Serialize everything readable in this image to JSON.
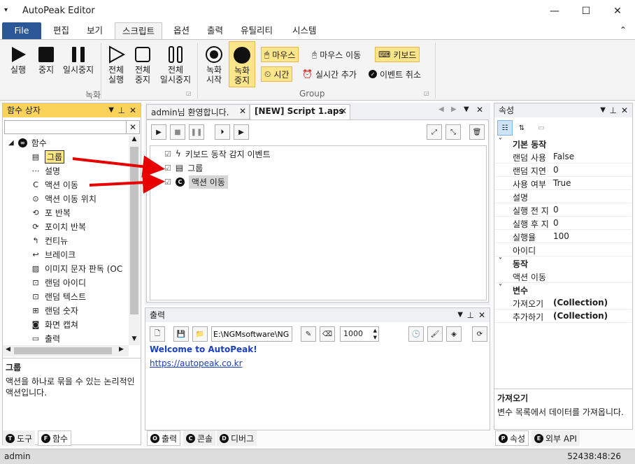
{
  "window": {
    "title": "AutoPeak Editor",
    "menu_glyph": "▾",
    "min": "—",
    "max": "☐",
    "close": "✕"
  },
  "ribbon_tabs": [
    "File",
    "편집",
    "보기",
    "스크립트",
    "옵션",
    "출력",
    "유틸리티",
    "시스템"
  ],
  "ribbon_collapse": "⌃",
  "ribbon": {
    "record_group": {
      "label": "녹화",
      "buttons": [
        "실행",
        "중지",
        "일시중지",
        "전체\n실행",
        "전체\n중지",
        "전체\n일시중지"
      ]
    },
    "group_group": {
      "label": "Group",
      "record_start": "녹화\n시작",
      "record_stop": "녹화\n중지",
      "mouse": "마우스",
      "mouse_move": "마우스 이동",
      "keyboard": "키보드",
      "time": "시간",
      "realtime_add": "실시간 추가",
      "event_cancel": "이벤트 취소"
    }
  },
  "function_panel": {
    "title": "함수 상자",
    "root": "함수",
    "items": [
      "그룹",
      "설명",
      "액션 이동",
      "액션 이동 위치",
      "포 반복",
      "포이치 반복",
      "컨티뉴",
      "브레이크",
      "이미지 문자 판독 (OC",
      "랜덤 아이디",
      "랜덤 텍스트",
      "랜덤 숫자",
      "화면 캡쳐",
      "출력"
    ],
    "desc_title": "그룹",
    "desc_text": "액션을 하나로 묶을 수 있는 논리적인 액션입니다.",
    "tabs": [
      "도구",
      "함수"
    ]
  },
  "editor": {
    "tabs": [
      "admin님 환영합니다.",
      "[NEW] Script 1.aps"
    ],
    "script_items": [
      "키보드 동작 감지 이벤트",
      "그룹",
      "액션 이동"
    ]
  },
  "output": {
    "title": "출력",
    "path": "E:\\NGMsoftware\\NG",
    "count": "1000",
    "welcome": "Welcome to AutoPeak!",
    "link": "https://autopeak.co.kr",
    "tabs": [
      "출력",
      "콘솔",
      "디버그"
    ]
  },
  "properties": {
    "title": "속성",
    "sections": [
      {
        "name": "기본 동작",
        "rows": [
          [
            "랜덤 사용",
            "False"
          ],
          [
            "랜덤 지연",
            "0"
          ],
          [
            "사용 여부",
            "True"
          ],
          [
            "설명",
            ""
          ],
          [
            "실행 전 지",
            "0"
          ],
          [
            "실행 후 지",
            "0"
          ],
          [
            "실행율",
            "100"
          ],
          [
            "아이디",
            ""
          ]
        ]
      },
      {
        "name": "동작",
        "rows": [
          [
            "액션 이동",
            ""
          ]
        ]
      },
      {
        "name": "변수",
        "rows": [
          [
            "가져오기",
            "(Collection)"
          ],
          [
            "추가하기",
            "(Collection)"
          ]
        ]
      }
    ],
    "desc_title": "가져오기",
    "desc_text": "변수 목록에서 데이터를 가져옵니다.",
    "tabs": [
      "속성",
      "외부 API"
    ]
  },
  "status": {
    "user": "admin",
    "time": "52438:48:26"
  },
  "colors": {
    "accent": "#2b5797",
    "highlight": "#fde68a",
    "panel_active": "#fcd35a",
    "arrow": "#e60000"
  }
}
